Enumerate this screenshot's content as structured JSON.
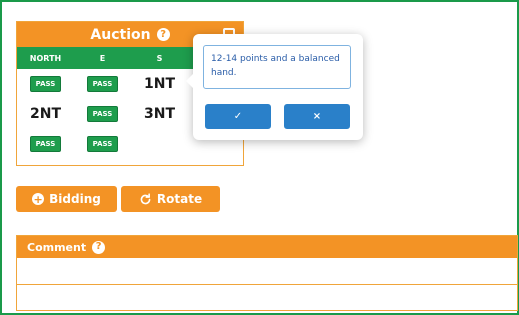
{
  "auction": {
    "title": "Auction",
    "directions": [
      "NORTH",
      "E",
      "S"
    ],
    "rows": [
      [
        "PASS",
        "PASS",
        "1NT"
      ],
      [
        "2NT",
        "PASS",
        "3NT"
      ],
      [
        "PASS",
        "PASS",
        ""
      ]
    ]
  },
  "popover": {
    "text": "12-14 points and a balanced hand.",
    "confirm_icon": "✓",
    "cancel_icon": "×"
  },
  "buttons": {
    "bidding": "Bidding",
    "rotate": "Rotate"
  },
  "comment": {
    "title": "Comment",
    "value": ""
  },
  "colors": {
    "orange": "#f39325",
    "green": "#1e9d4d",
    "blue": "#2a80c9"
  }
}
